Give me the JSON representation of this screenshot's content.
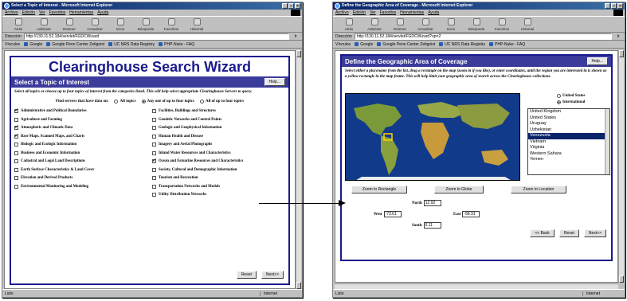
{
  "left_window": {
    "title": "Select a Topic of Interest - Microsoft Internet Explorer",
    "menu": [
      "Archivo",
      "Edición",
      "Ver",
      "Favoritos",
      "Herramientas",
      "Ayuda"
    ],
    "toolbar": [
      "Atrás",
      "Adelante",
      "Detener",
      "Actualizar",
      "Inicio",
      "Búsqueda",
      "Favoritos",
      "Historial"
    ],
    "address_label": "Dirección",
    "address_value": "http://130.11.52.184/servlet/FGDCWizard",
    "go_label": "Ir",
    "links_label": "Vínculos",
    "links": [
      "Google",
      "Google Penn Center Zeitgeist",
      "UC NRS Data Registry",
      "PHP-Nuke - FAQ"
    ],
    "status_left": "Listo",
    "status_right": "Internet",
    "page": {
      "title": "Clearinghouse Search Wizard",
      "bar_title": "Select a Topic of Interest",
      "help_label": "Help...",
      "instructions": "Select all topics or choose up to four topics of interest from the categories listed. This will help select appropriate Clearinghouse Servers to query.",
      "find_label": "Find servers that have data on:",
      "radio_options": [
        {
          "label": "All topics",
          "selected": false
        },
        {
          "label": "Any one of up to four topics",
          "selected": true
        },
        {
          "label": "All of up to four topics",
          "selected": false
        }
      ],
      "topics_left": [
        {
          "label": "Administrative and Political Boundaries",
          "checked": true
        },
        {
          "label": "Agriculture and Farming",
          "checked": false
        },
        {
          "label": "Atmospheric and Climatic Data",
          "checked": true
        },
        {
          "label": "Base Maps, Scanned Maps, and Charts",
          "checked": true
        },
        {
          "label": "Biologic and Ecologic Information",
          "checked": false
        },
        {
          "label": "Business and Economic Information",
          "checked": false
        },
        {
          "label": "Cadastral and Legal Land Descriptions",
          "checked": false
        },
        {
          "label": "Earth Surface Characteristics & Land Cover",
          "checked": false
        },
        {
          "label": "Elevation and Derived Products",
          "checked": false
        },
        {
          "label": "Environmental Monitoring and Modeling",
          "checked": false
        }
      ],
      "topics_right": [
        {
          "label": "Facilities, Buildings and Structures",
          "checked": false
        },
        {
          "label": "Geodetic Networks and Control Points",
          "checked": false
        },
        {
          "label": "Geologic and Geophysical Information",
          "checked": false
        },
        {
          "label": "Human Health and Disease",
          "checked": false
        },
        {
          "label": "Imagery and Aerial Photographs",
          "checked": false
        },
        {
          "label": "Inland Water Resources and Characteristics",
          "checked": false
        },
        {
          "label": "Ocean and Estuarine Resources and Characteristics",
          "checked": true
        },
        {
          "label": "Society, Cultural and Demographic Information",
          "checked": false
        },
        {
          "label": "Tourism and Recreation",
          "checked": false
        },
        {
          "label": "Transportation Networks and Models",
          "checked": false
        },
        {
          "label": "Utility Distribution Networks",
          "checked": false
        }
      ],
      "reset_label": "Reset",
      "next_label": "Next>>"
    }
  },
  "right_window": {
    "title": "Define the Geographic Area of Coverage - Microsoft Internet Explorer",
    "address_value": "http://130.11.52.184/servlet/FGDCWizard?op=2",
    "page": {
      "bar_title": "Define the Geographic Area of Coverage",
      "help_label": "Help...",
      "instructions": "Select either a placename from the list, drag a rectangle on the map (zoom in if you like), or enter coordinates, until the region you are interested in is shown as a yellow rectangle in the map frame. This will help limit your geographic area of search across the Clearinghouse collections.",
      "coverage_options": [
        {
          "label": "United States",
          "selected": false
        },
        {
          "label": "International",
          "selected": true
        }
      ],
      "places": [
        "United Kingdom",
        "United States",
        "Uruguay",
        "Uzbekistan",
        "Venezuela",
        "Vietnam",
        "Virginia",
        "Western Sahara",
        "Yemen"
      ],
      "selected_place": "Venezuela",
      "zoom_rect_label": "Zoom to Rectangle",
      "zoom_globe_label": "Zoom to Globe",
      "zoom_location_label": "Zoom to Location",
      "north_label": "North",
      "north_value": "12.92",
      "west_label": "West",
      "west_value": "-73.61",
      "east_label": "East",
      "east_value": "-58.91",
      "south_label": "South",
      "south_value": "0.11",
      "back_label": "<< Back",
      "reset_label": "Reset",
      "next_label": "Next>>"
    }
  },
  "colors": {
    "titlebar": "#0a246a",
    "wizard_accent": "#1a1a8c",
    "map_ocean": "#123a8a",
    "selection_box": "#ffd400"
  }
}
